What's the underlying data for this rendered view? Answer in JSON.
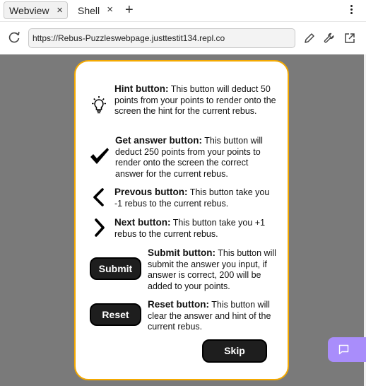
{
  "tabs": [
    {
      "label": "Webview",
      "close": "×"
    },
    {
      "label": "Shell",
      "close": "×"
    }
  ],
  "new_tab": "+",
  "address": {
    "url": "https://Rebus-Puzzleswebpage.justtestit134.repl.co"
  },
  "colors": {
    "accent": "#f4a900",
    "backdrop": "#7a7a7a",
    "fab": "#a98dfb",
    "button": "#1e1e1e"
  },
  "help": {
    "hint": {
      "title": "Hint button:",
      "text": " This button will deduct 50 points from your points to render onto the screen the hint for the current rebus."
    },
    "answer": {
      "title": "Get answer button:",
      "text": " This button will deduct 250 points from your points to render onto the screen the correct answer for the current rebus."
    },
    "prev": {
      "title": "Prevous button:",
      "text": " This button take you -1 rebus to the current rebus."
    },
    "next": {
      "title": "Next button:",
      "text": " This button take you +1 rebus to the current rebus."
    },
    "submit": {
      "button": "Submit",
      "title": "Submit button:",
      "text": " This button will submit the answer you input, if answer is correct, 200 will be added to your points."
    },
    "reset": {
      "button": "Reset",
      "title": "Reset button:",
      "text": " This button will clear the answer and hint of the current rebus."
    }
  },
  "skip_label": "Skip"
}
